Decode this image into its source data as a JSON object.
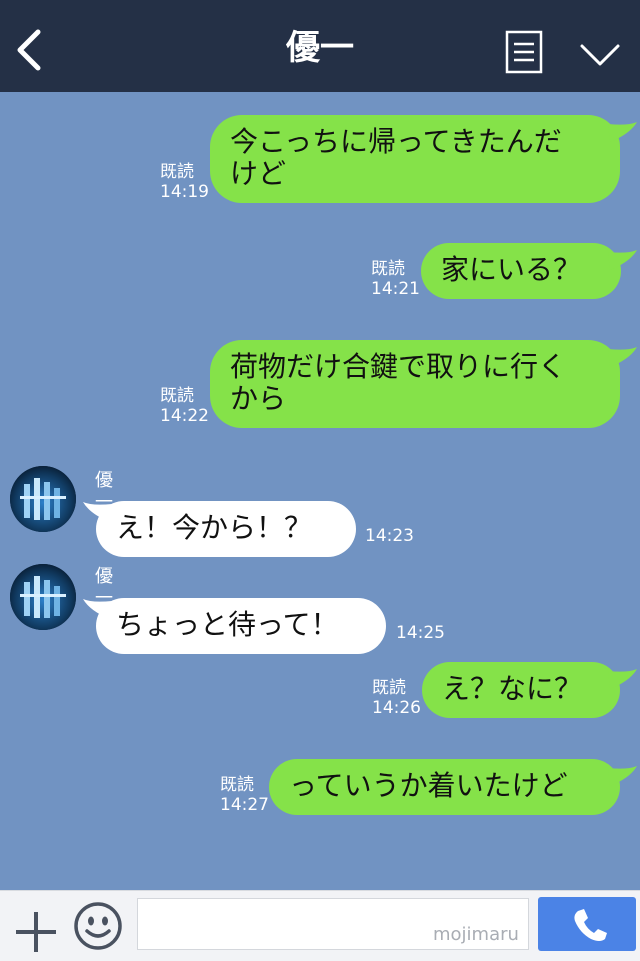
{
  "header": {
    "title": "優一"
  },
  "messages": [
    {
      "side": "right",
      "text": "今こっちに帰ってきたんだ\nけど",
      "read": "既読",
      "time": "14:19"
    },
    {
      "side": "right",
      "text": "家にいる？",
      "read": "既読",
      "time": "14:21"
    },
    {
      "side": "right",
      "text": "荷物だけ合鍵で取りに行く\nから",
      "read": "既読",
      "time": "14:22"
    },
    {
      "side": "left",
      "sender": "優一",
      "text": "え！今から！？",
      "time": "14:23"
    },
    {
      "side": "left",
      "sender": "優一",
      "text": "ちょっと待って！",
      "time": "14:25"
    },
    {
      "side": "right",
      "text": "え？なに？",
      "read": "既読",
      "time": "14:26"
    },
    {
      "side": "right",
      "text": "っていうか着いたけど",
      "read": "既読",
      "time": "14:27"
    }
  ],
  "input": {
    "watermark": "mojimaru"
  },
  "colors": {
    "header_bg": "#243046",
    "chat_bg": "#7193c2",
    "bubble_sent": "#85e249",
    "bubble_received": "#ffffff",
    "call_button": "#4b83e6"
  },
  "icons": {
    "back": "chevron-left-icon",
    "notes": "notes-icon",
    "menu": "chevron-down-icon",
    "add": "plus-icon",
    "emoji": "smiley-icon",
    "call": "phone-icon"
  }
}
